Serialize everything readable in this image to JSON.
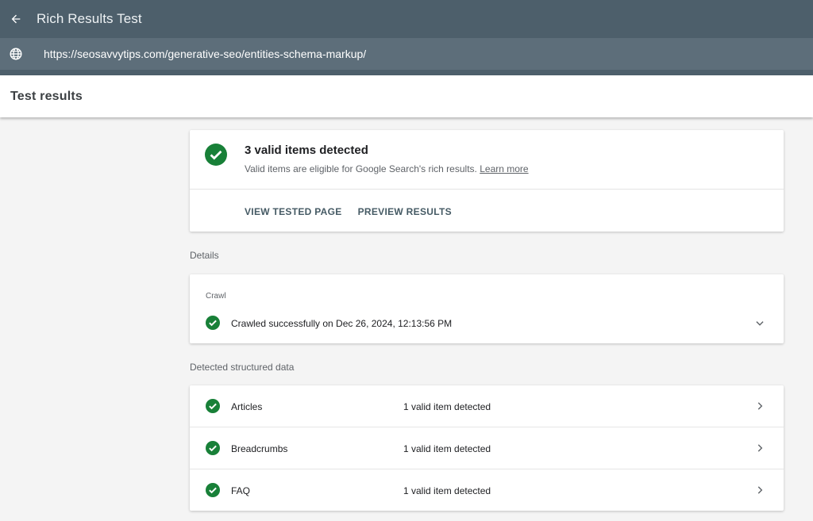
{
  "app": {
    "title": "Rich Results Test",
    "url": "https://seosavvytips.com/generative-seo/entities-schema-markup/"
  },
  "header": {
    "title": "Test results"
  },
  "summary": {
    "title": "3 valid items detected",
    "subtitle": "Valid items are eligible for Google Search's rich results.",
    "learn_more": "Learn more",
    "view_tested_page": "VIEW TESTED PAGE",
    "preview_results": "PREVIEW RESULTS"
  },
  "details": {
    "label": "Details",
    "crawl_label": "Crawl",
    "crawl_status": "Crawled successfully on Dec 26, 2024, 12:13:56 PM"
  },
  "structured_data": {
    "label": "Detected structured data",
    "items": [
      {
        "name": "Articles",
        "status": "1 valid item detected"
      },
      {
        "name": "Breadcrumbs",
        "status": "1 valid item detected"
      },
      {
        "name": "FAQ",
        "status": "1 valid item detected"
      }
    ]
  },
  "colors": {
    "appbar": "#4d5f6b",
    "urlbar": "#5d6e7a",
    "valid_green": "#188038"
  }
}
